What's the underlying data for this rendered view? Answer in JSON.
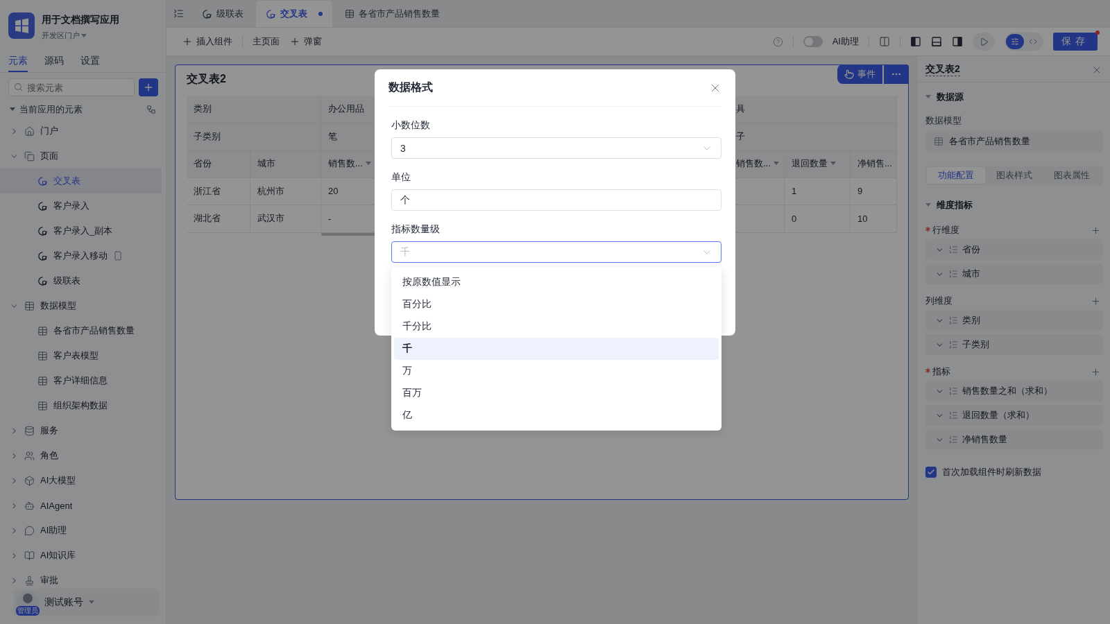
{
  "app": {
    "name": "用于文档撰写应用",
    "portal": "开发区门户"
  },
  "sidebar_tabs": [
    {
      "label": "元素",
      "selected": true
    },
    {
      "label": "源码",
      "selected": false
    },
    {
      "label": "设置",
      "selected": false
    }
  ],
  "search": {
    "placeholder": "搜索元素"
  },
  "elements_section": {
    "title": "当前应用的元素",
    "expanded": true
  },
  "tree": [
    {
      "label": "门户",
      "kind": "portal",
      "expanded": false
    },
    {
      "label": "页面",
      "kind": "pages",
      "expanded": true,
      "children": [
        {
          "label": "交叉表",
          "kind": "page",
          "selected": true,
          "mobile": false
        },
        {
          "label": "客户录入",
          "kind": "page",
          "selected": false,
          "mobile": false
        },
        {
          "label": "客户录入_副本",
          "kind": "page",
          "selected": false,
          "mobile": false
        },
        {
          "label": "客户录入移动",
          "kind": "page",
          "selected": false,
          "mobile": true
        },
        {
          "label": "级联表",
          "kind": "page",
          "selected": false,
          "mobile": false
        }
      ]
    },
    {
      "label": "数据模型",
      "kind": "models",
      "expanded": true,
      "children": [
        {
          "label": "各省市产品销售数量",
          "kind": "model",
          "selected": false,
          "mobile": false
        },
        {
          "label": "客户表模型",
          "kind": "model",
          "selected": false,
          "mobile": false
        },
        {
          "label": "客户详细信息",
          "kind": "model",
          "selected": false,
          "mobile": false
        },
        {
          "label": "组织架构数据",
          "kind": "model",
          "selected": false,
          "mobile": false
        }
      ]
    },
    {
      "label": "服务",
      "kind": "service",
      "expanded": false
    },
    {
      "label": "角色",
      "kind": "role",
      "expanded": false
    },
    {
      "label": "AI大模型",
      "kind": "llm",
      "expanded": false
    },
    {
      "label": "AIAgent",
      "kind": "agent",
      "expanded": false
    },
    {
      "label": "AI助理",
      "kind": "assistant",
      "expanded": false
    },
    {
      "label": "AI知识库",
      "kind": "knowledge",
      "expanded": false
    },
    {
      "label": "审批",
      "kind": "approval",
      "expanded": false
    }
  ],
  "user": {
    "name": "测试账号",
    "badge": "管理员"
  },
  "editor_tabs": [
    {
      "label": "级联表",
      "kind": "page",
      "selected": false,
      "unsaved": false
    },
    {
      "label": "交叉表",
      "kind": "page",
      "selected": true,
      "unsaved": true
    },
    {
      "label": "各省市产品销售数量",
      "kind": "model",
      "selected": false,
      "unsaved": false
    }
  ],
  "toolbar": {
    "insert": "插入组件",
    "home": "主页面",
    "popup": "弹窗"
  },
  "top_right": {
    "assistant": {
      "label": "AI助理",
      "on": false
    },
    "panels": [
      {
        "kind": "left",
        "on": true
      },
      {
        "kind": "bottom",
        "on": false
      },
      {
        "kind": "right",
        "on": true
      }
    ],
    "view_modes": [
      {
        "kind": "config",
        "selected": true
      },
      {
        "kind": "code",
        "selected": false
      }
    ],
    "save": {
      "label": "保存",
      "notification": true
    }
  },
  "canvas": {
    "title": "交叉表2",
    "event_button": "事件",
    "table": {
      "group_row": [
        "类别",
        "办公用品",
        "具"
      ],
      "subgroup_row": [
        "子类别",
        "笔",
        "子"
      ],
      "columns": [
        {
          "label": "省份",
          "sortable": false
        },
        {
          "label": "城市",
          "sortable": false
        },
        {
          "label": "销售数...",
          "sortable": true
        },
        {
          "label": "销售数...",
          "sortable": true
        },
        {
          "label": "退回数量",
          "sortable": true
        },
        {
          "label": "净销售...",
          "sortable": false
        }
      ],
      "rows": [
        {
          "province": "浙江省",
          "city": "杭州市",
          "column_3": "20",
          "returns": "1",
          "net": "9"
        },
        {
          "province": "湖北省",
          "city": "武汉市",
          "column_3": "-",
          "returns": "0",
          "net": "10"
        }
      ]
    }
  },
  "inspector": {
    "title": "交叉表2",
    "data_source": {
      "heading": "数据源",
      "expanded": true,
      "label": "数据模型",
      "model": "各省市产品销售数量"
    },
    "tabs": [
      {
        "label": "功能配置",
        "selected": true
      },
      {
        "label": "图表样式",
        "selected": false
      },
      {
        "label": "图表属性",
        "selected": false
      }
    ],
    "dimensions": {
      "heading": "维度指标",
      "expanded": true,
      "groups": [
        {
          "label": "行维度",
          "required": true,
          "fields": [
            "省份",
            "城市"
          ]
        },
        {
          "label": "列维度",
          "required": false,
          "fields": [
            "类别",
            "子类别"
          ]
        },
        {
          "label": "指标",
          "required": true,
          "fields": [
            "销售数量之和（求和）",
            "退回数量（求和）",
            "净销售数量"
          ]
        }
      ]
    },
    "refresh_on_load": {
      "label": "首次加载组件时刷新数据",
      "checked": true
    }
  },
  "dialog": {
    "title": "数据格式",
    "fields": [
      {
        "label": "小数位数",
        "kind": "select",
        "value": "3",
        "open": false
      },
      {
        "label": "单位",
        "kind": "input",
        "value": "个"
      },
      {
        "label": "指标数量级",
        "kind": "select",
        "placeholder": "千",
        "open": true,
        "options": [
          {
            "label": "按原数值显示",
            "selected": false
          },
          {
            "label": "百分比",
            "selected": false
          },
          {
            "label": "千分比",
            "selected": false
          },
          {
            "label": "千",
            "selected": true
          },
          {
            "label": "万",
            "selected": false
          },
          {
            "label": "百万",
            "selected": false
          },
          {
            "label": "亿",
            "selected": false
          }
        ]
      }
    ]
  }
}
